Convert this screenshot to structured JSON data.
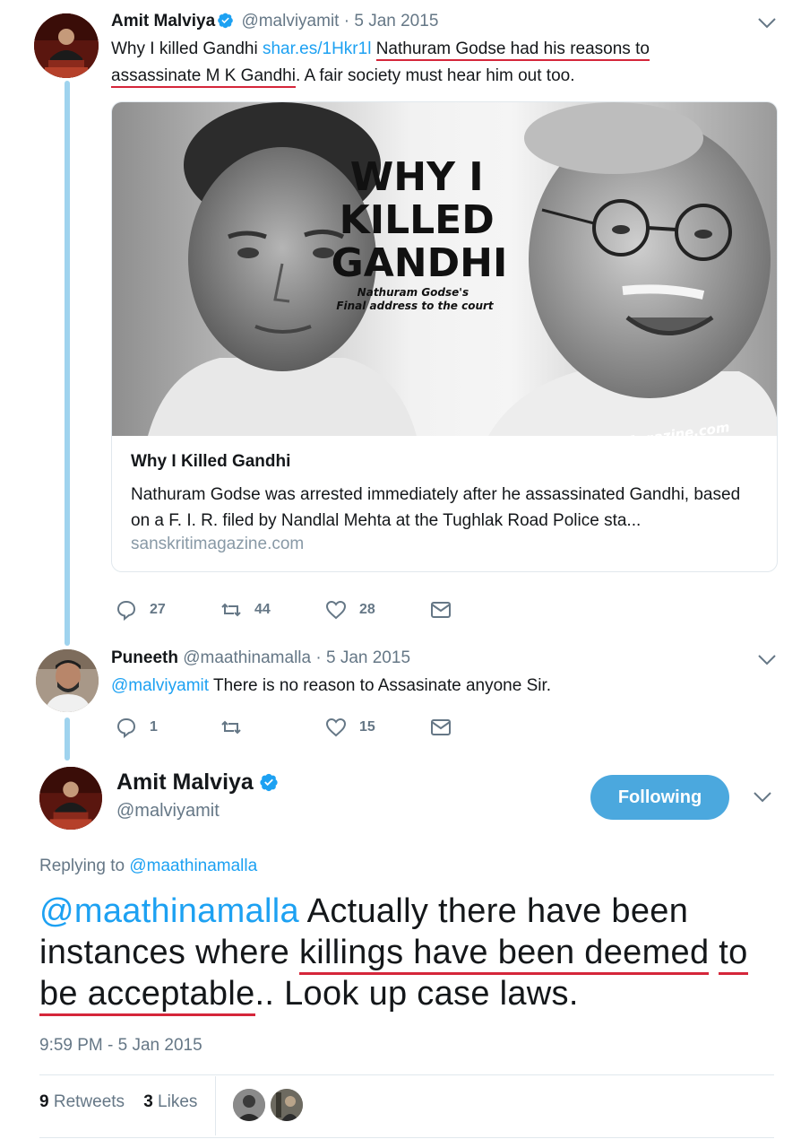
{
  "tweet1": {
    "name": "Amit Malviya",
    "handle": "@malviyamit",
    "separator": "·",
    "date": "5 Jan 2015",
    "text_prefix": "Why I killed Gandhi ",
    "link": "shar.es/1Hkr1l",
    "text_space": " ",
    "text_underlined_1": "Nathuram Godse had his reasons to",
    "text_underlined_2": "assassinate M K Gandhi",
    "text_suffix": ". A fair society must hear him out too.",
    "card": {
      "image_title_lines": [
        "WHY I",
        "KILLED",
        "GANDHI"
      ],
      "image_subtitle_lines": [
        "Nathuram Godse's",
        "Final address to the court"
      ],
      "image_watermark": "...Magazine.com",
      "title": "Why I Killed Gandhi",
      "description": "Nathuram Godse was arrested immediately after he assassinated Gandhi, based on a F. I. R. filed by Nandlal Mehta at the Tughlak Road Police sta...",
      "domain": "sanskritimagazine.com"
    },
    "replies": "27",
    "retweets": "44",
    "likes": "28"
  },
  "tweet2": {
    "name": "Puneeth",
    "handle": "@maathinamalla",
    "separator": "·",
    "date": "5 Jan 2015",
    "mention": "@malviyamit",
    "text": " There is no reason to Assasinate anyone Sir.",
    "replies": "1",
    "retweets": "",
    "likes": "15"
  },
  "main_tweet": {
    "name": "Amit Malviya",
    "handle": "@malviyamit",
    "follow_label": "Following",
    "replying_label": "Replying to ",
    "replying_to": "@maathinamalla",
    "mention": "@maathinamalla",
    "text_1": " Actually there have been instances where ",
    "text_underlined_1": "killings have been deemed",
    "text_space": " ",
    "text_underlined_2": "to be acceptable",
    "text_2": ".. Look up case laws.",
    "timestamp": "9:59 PM - 5 Jan 2015",
    "retweet_count": "9",
    "retweet_label": " Retweets",
    "like_count": "3",
    "like_label": " Likes"
  },
  "colors": {
    "link": "#1da1f2",
    "underline": "#d5263a",
    "thread_line": "#9fd3ee",
    "follow_button": "#4ba8de",
    "muted": "#657786"
  },
  "icons": [
    "verified-badge-icon",
    "chevron-down-icon",
    "reply-icon",
    "retweet-icon",
    "like-icon",
    "direct-message-icon"
  ]
}
